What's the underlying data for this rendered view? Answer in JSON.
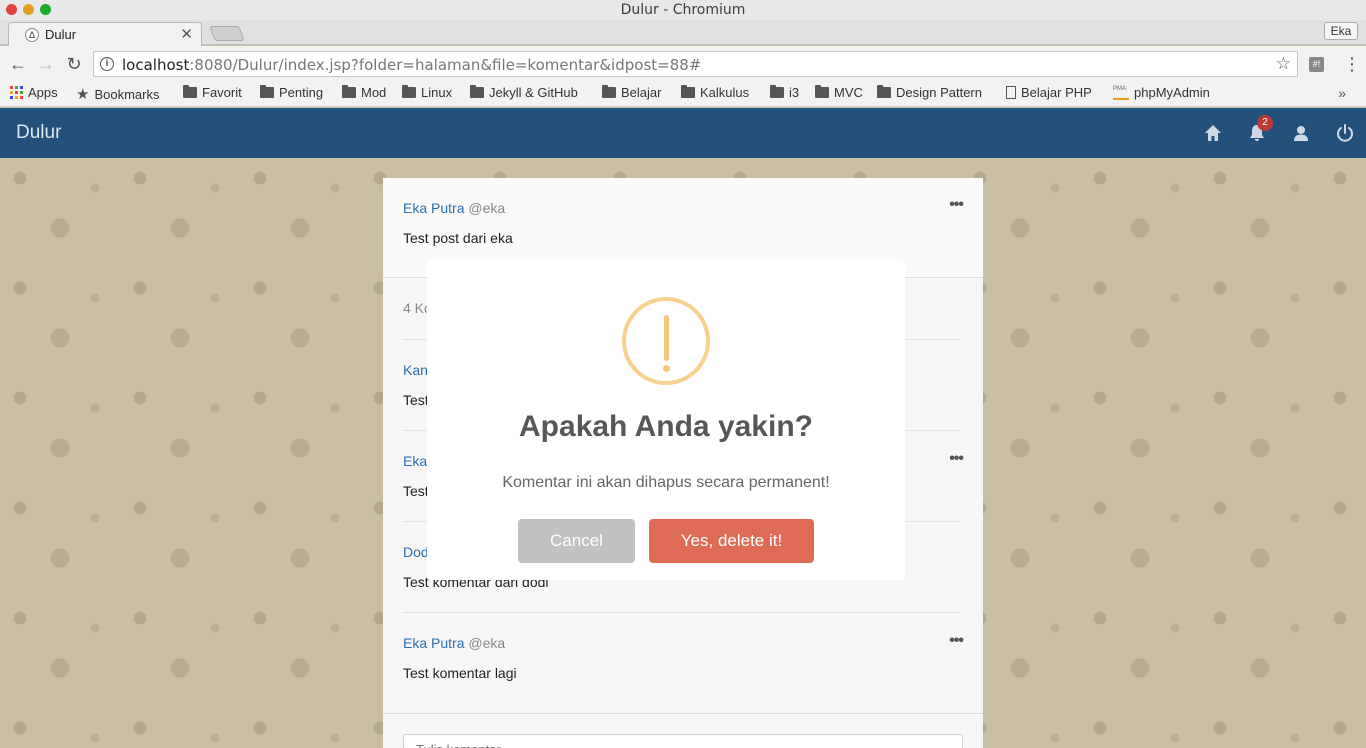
{
  "window": {
    "title": "Dulur - Chromium",
    "profile": "Eka"
  },
  "tab": {
    "title": "Dulur",
    "favicon": "Δ"
  },
  "omnibox": {
    "url_host": "localhost",
    "url_rest": ":8080/Dulur/index.jsp?folder=halaman&file=komentar&idpost=88#"
  },
  "bookmarks": [
    "Apps",
    "Bookmarks",
    "Favorit",
    "Penting",
    "Mod",
    "Linux",
    "Jekyll & GitHub",
    "Belajar",
    "Kalkulus",
    "i3",
    "MVC",
    "Design Pattern",
    "Belajar PHP",
    "phpMyAdmin"
  ],
  "navbar": {
    "brand": "Dulur",
    "notification_count": "2"
  },
  "post": {
    "author": "Eka Putra",
    "handle": "@eka",
    "text": "Test post dari eka",
    "comment_count": "4 Ko"
  },
  "comments": [
    {
      "author": "Kan",
      "handle": "",
      "text": "Test"
    },
    {
      "author": "Eka",
      "handle": "",
      "text": "Test"
    },
    {
      "author": "Dod",
      "handle": "",
      "text": "Test komentar dari dodi"
    },
    {
      "author": "Eka Putra",
      "handle": "@eka",
      "text": "Test komentar lagi"
    }
  ],
  "comment_input": {
    "placeholder": "Tulis komentar..."
  },
  "modal": {
    "title": "Apakah Anda yakin?",
    "text": "Komentar ini akan dihapus secara permanent!",
    "cancel_label": "Cancel",
    "confirm_label": "Yes, delete it!"
  },
  "colors": {
    "navbar": "#24507c",
    "confirm": "#dd6b55",
    "cancel": "#c1c1c1",
    "warning": "#f8d08f",
    "link": "#2c6fad"
  }
}
